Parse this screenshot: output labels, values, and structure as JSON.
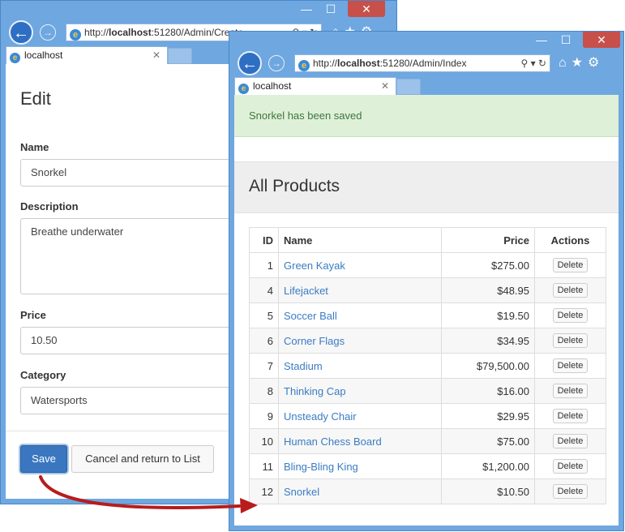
{
  "edit_window": {
    "address": {
      "prefix": "http://",
      "host": "localhost",
      "rest": ":51280/Admin/Create"
    },
    "tab_label": "localhost",
    "heading": "Edit",
    "fields": [
      {
        "label": "Name",
        "value": "Snorkel"
      },
      {
        "label": "Description",
        "value": "Breathe underwater"
      },
      {
        "label": "Price",
        "value": "10.50"
      },
      {
        "label": "Category",
        "value": "Watersports"
      }
    ],
    "save_label": "Save",
    "cancel_label": "Cancel and return to List"
  },
  "index_window": {
    "address": {
      "prefix": "http://",
      "host": "localhost",
      "rest": ":51280/Admin/Index"
    },
    "tab_label": "localhost",
    "alert": "Snorkel has been saved",
    "heading": "All Products",
    "columns": [
      "ID",
      "Name",
      "Price",
      "Actions"
    ],
    "delete_label": "Delete",
    "rows": [
      {
        "id": "1",
        "name": "Green Kayak",
        "price": "$275.00"
      },
      {
        "id": "4",
        "name": "Lifejacket",
        "price": "$48.95"
      },
      {
        "id": "5",
        "name": "Soccer Ball",
        "price": "$19.50"
      },
      {
        "id": "6",
        "name": "Corner Flags",
        "price": "$34.95"
      },
      {
        "id": "7",
        "name": "Stadium",
        "price": "$79,500.00"
      },
      {
        "id": "8",
        "name": "Thinking Cap",
        "price": "$16.00"
      },
      {
        "id": "9",
        "name": "Unsteady Chair",
        "price": "$29.95"
      },
      {
        "id": "10",
        "name": "Human Chess Board",
        "price": "$75.00"
      },
      {
        "id": "11",
        "name": "Bling-Bling King",
        "price": "$1,200.00"
      },
      {
        "id": "12",
        "name": "Snorkel",
        "price": "$10.50"
      }
    ]
  },
  "colors": {
    "frame": "#6fa7e0",
    "primary": "#3a77c0",
    "link": "#3a7cc2",
    "alert_bg": "#dff0d8",
    "alert_text": "#3c763d",
    "arrow": "#b81c1c"
  }
}
